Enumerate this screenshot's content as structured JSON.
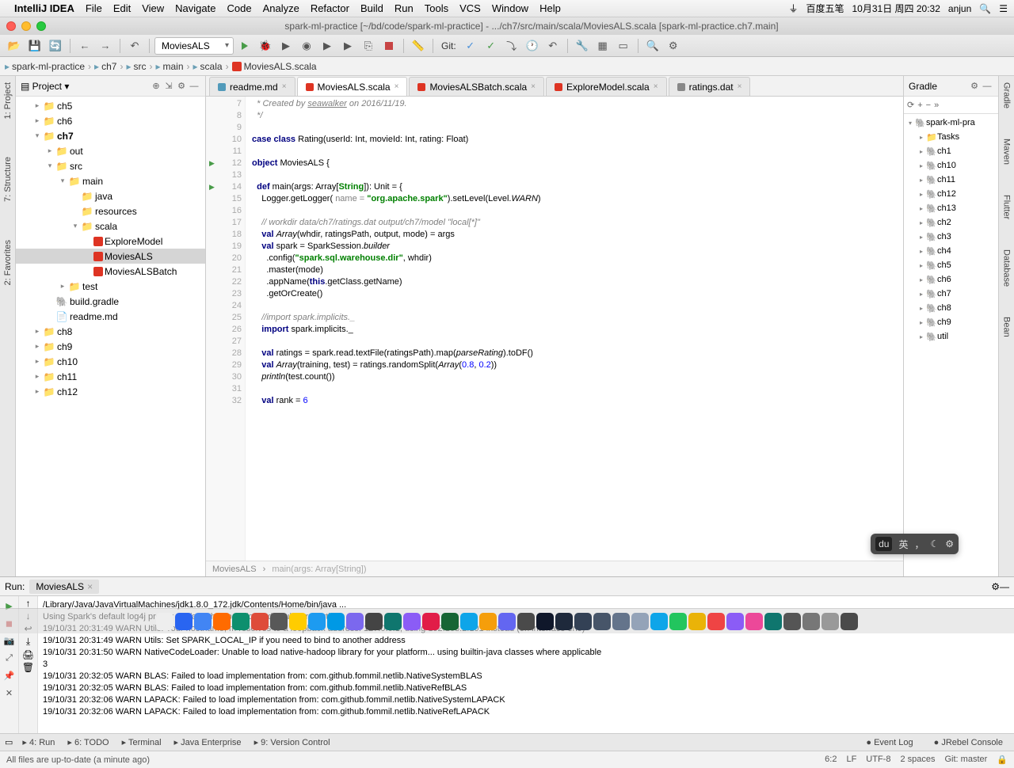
{
  "menubar": {
    "app": "IntelliJ IDEA",
    "items": [
      "File",
      "Edit",
      "View",
      "Navigate",
      "Code",
      "Analyze",
      "Refactor",
      "Build",
      "Run",
      "Tools",
      "VCS",
      "Window",
      "Help"
    ],
    "right": {
      "ime": "百度五笔",
      "date": "10月31日 周四 20:32",
      "user": "anjun"
    }
  },
  "window_title": "spark-ml-practice [~/bd/code/spark-ml-practice] - .../ch7/src/main/scala/MoviesALS.scala [spark-ml-practice.ch7.main]",
  "run_config": "MoviesALS",
  "git_label": "Git:",
  "breadcrumbs": [
    "spark-ml-practice",
    "ch7",
    "src",
    "main",
    "scala",
    "MoviesALS.scala"
  ],
  "project_panel": {
    "title": "Project"
  },
  "tree": {
    "items": [
      {
        "depth": 1,
        "tw": "▸",
        "icon": "folder",
        "label": "ch5"
      },
      {
        "depth": 1,
        "tw": "▸",
        "icon": "folder",
        "label": "ch6"
      },
      {
        "depth": 1,
        "tw": "▾",
        "icon": "folder",
        "label": "ch7",
        "bold": true
      },
      {
        "depth": 2,
        "tw": "▸",
        "icon": "folder-red",
        "label": "out"
      },
      {
        "depth": 2,
        "tw": "▾",
        "icon": "folder-blue",
        "label": "src"
      },
      {
        "depth": 3,
        "tw": "▾",
        "icon": "folder-blue",
        "label": "main"
      },
      {
        "depth": 4,
        "tw": "",
        "icon": "folder-blue",
        "label": "java"
      },
      {
        "depth": 4,
        "tw": "",
        "icon": "folder",
        "label": "resources"
      },
      {
        "depth": 4,
        "tw": "▾",
        "icon": "folder-blue",
        "label": "scala"
      },
      {
        "depth": 5,
        "tw": "",
        "icon": "scala-f",
        "label": "ExploreModel"
      },
      {
        "depth": 5,
        "tw": "",
        "icon": "scala-f",
        "label": "MoviesALS",
        "selected": true
      },
      {
        "depth": 5,
        "tw": "",
        "icon": "scala-f",
        "label": "MoviesALSBatch"
      },
      {
        "depth": 3,
        "tw": "▸",
        "icon": "folder",
        "label": "test"
      },
      {
        "depth": 2,
        "tw": "",
        "icon": "gradle",
        "label": "build.gradle"
      },
      {
        "depth": 2,
        "tw": "",
        "icon": "file",
        "label": "readme.md"
      },
      {
        "depth": 1,
        "tw": "▸",
        "icon": "folder",
        "label": "ch8"
      },
      {
        "depth": 1,
        "tw": "▸",
        "icon": "folder",
        "label": "ch9"
      },
      {
        "depth": 1,
        "tw": "▸",
        "icon": "folder",
        "label": "ch10"
      },
      {
        "depth": 1,
        "tw": "▸",
        "icon": "folder",
        "label": "ch11"
      },
      {
        "depth": 1,
        "tw": "▸",
        "icon": "folder",
        "label": "ch12"
      }
    ]
  },
  "editor_tabs": [
    {
      "icon": "md",
      "label": "readme.md",
      "active": false,
      "close": true
    },
    {
      "icon": "sc",
      "label": "MoviesALS.scala",
      "active": true,
      "close": true
    },
    {
      "icon": "sc",
      "label": "MoviesALSBatch.scala",
      "active": false,
      "close": true
    },
    {
      "icon": "sc",
      "label": "ExploreModel.scala",
      "active": false,
      "close": true
    },
    {
      "icon": "dat",
      "label": "ratings.dat",
      "active": false,
      "close": true
    }
  ],
  "code": {
    "first_line": 7,
    "lines": [
      {
        "n": 7,
        "html": "  <span class='cm'>* Created by <u>seawalker</u> on 2016/11/19.</span>"
      },
      {
        "n": 8,
        "html": "  <span class='cm'>*/</span>"
      },
      {
        "n": 9,
        "html": ""
      },
      {
        "n": 10,
        "html": "<span class='kw'>case class</span> Rating(userId: Int, movieId: Int, rating: Float)"
      },
      {
        "n": 11,
        "html": ""
      },
      {
        "n": 12,
        "run": true,
        "html": "<span class='kw'>object</span> MoviesALS {"
      },
      {
        "n": 13,
        "html": ""
      },
      {
        "n": 14,
        "run": true,
        "html": "  <span class='kw'>def</span> main(args: Array[<span class='str'>String</span>]): Unit = {"
      },
      {
        "n": 15,
        "html": "    Logger.getLogger( <span class='param'>name =</span> <span class='str'>\"org.apache.spark\"</span>).setLevel(Level.<span class='fn'>WARN</span>)"
      },
      {
        "n": 16,
        "html": ""
      },
      {
        "n": 17,
        "html": "    <span class='cm'>// workdir data/ch7/ratings.dat output/ch7/model \"local[*]\"</span>"
      },
      {
        "n": 18,
        "html": "    <span class='kw'>val</span> <span class='fn'>Array</span>(whdir, ratingsPath, output, mode) = args"
      },
      {
        "n": 19,
        "html": "    <span class='kw'>val</span> spark = SparkSession.<span class='fn'>builder</span>"
      },
      {
        "n": 20,
        "html": "      .config(<span class='str'>\"spark.sql.warehouse.dir\"</span>, whdir)"
      },
      {
        "n": 21,
        "html": "      .master(mode)"
      },
      {
        "n": 22,
        "html": "      .appName(<span class='kw'>this</span>.getClass.getName)"
      },
      {
        "n": 23,
        "html": "      .getOrCreate()"
      },
      {
        "n": 24,
        "html": ""
      },
      {
        "n": 25,
        "html": "    <span class='cm'>//import spark.implicits._</span>"
      },
      {
        "n": 26,
        "html": "    <span class='kw'>import</span> spark.implicits._"
      },
      {
        "n": 27,
        "html": ""
      },
      {
        "n": 28,
        "html": "    <span class='kw'>val</span> ratings = spark.read.textFile(ratingsPath).map(<span class='fn'>parseRating</span>).toDF()"
      },
      {
        "n": 29,
        "html": "    <span class='kw'>val</span> <span class='fn'>Array</span>(training, test) = ratings.randomSplit(<span class='fn'>Array</span>(<span class='num'>0.8</span>, <span class='num'>0.2</span>))"
      },
      {
        "n": 30,
        "html": "    <span class='fn'>println</span>(test.count())"
      },
      {
        "n": 31,
        "html": ""
      },
      {
        "n": 32,
        "html": "    <span class='kw'>val</span> rank = <span class='num'>6</span>"
      }
    ]
  },
  "editor_breadcrumb": [
    "MoviesALS",
    "main(args: Array[String])"
  ],
  "gradle": {
    "title": "Gradle",
    "root": "spark-ml-pra",
    "items": [
      "Tasks",
      "ch1",
      "ch10",
      "ch11",
      "ch12",
      "ch13",
      "ch2",
      "ch3",
      "ch4",
      "ch5",
      "ch6",
      "ch7",
      "ch8",
      "ch9",
      "util"
    ]
  },
  "run": {
    "title": "Run:",
    "tab": "MoviesALS",
    "lines": [
      "/Library/Java/JavaVirtualMachines/jdk1.8.0_172.jdk/Contents/Home/bin/java ...",
      "Using Spark's default log4j profile: org/apache/spark/log4j-defaults.properties",
      "19/10/31 20:31:49 WARN Utils: Your hostname, m resolves to a loopback address: 127.0.0.1; using 192.168.2.101 instead (on interface en0)",
      "19/10/31 20:31:49 WARN Utils: Set SPARK_LOCAL_IP if you need to bind to another address",
      "19/10/31 20:31:50 WARN NativeCodeLoader: Unable to load native-hadoop library for your platform... using builtin-java classes where applicable",
      "3",
      "19/10/31 20:32:05 WARN BLAS: Failed to load implementation from: com.github.fommil.netlib.NativeSystemBLAS",
      "19/10/31 20:32:05 WARN BLAS: Failed to load implementation from: com.github.fommil.netlib.NativeRefBLAS",
      "19/10/31 20:32:06 WARN LAPACK: Failed to load implementation from: com.github.fommil.netlib.NativeSystemLAPACK",
      "19/10/31 20:32:06 WARN LAPACK: Failed to load implementation from: com.github.fommil.netlib.NativeRefLAPACK"
    ]
  },
  "bottom_tabs": {
    "left": [
      "4: Run",
      "6: TODO",
      "Terminal",
      "Java Enterprise",
      "9: Version Control"
    ],
    "right": [
      "Event Log",
      "JRebel Console"
    ]
  },
  "status": {
    "msg": "All files are up-to-date (a minute ago)",
    "pos": "6:2",
    "lf": "LF",
    "enc": "UTF-8",
    "indent": "2 spaces",
    "git": "Git: master"
  },
  "dock_colors": [
    "#eee",
    "#2965f1",
    "#4285f4",
    "#ff6b00",
    "#0e8f6e",
    "#de4c3a",
    "#585858",
    "#ffcc00",
    "#1d9bf0",
    "#0099e5",
    "#7b68ee",
    "#444",
    "#0f766e",
    "#8b5cf6",
    "#e11d48",
    "#166534",
    "#0ea5e9",
    "#f59e0b",
    "#6366f1",
    "#4a4a4a",
    "#0f172a",
    "#1e293b",
    "#334155",
    "#475569",
    "#64748b",
    "#94a3b8",
    "#0ea5e9",
    "#22c55e",
    "#eab308",
    "#ef4444",
    "#8b5cf6",
    "#ec4899",
    "#0f766e",
    "#555",
    "#777",
    "#999",
    "#4a4a4a"
  ]
}
